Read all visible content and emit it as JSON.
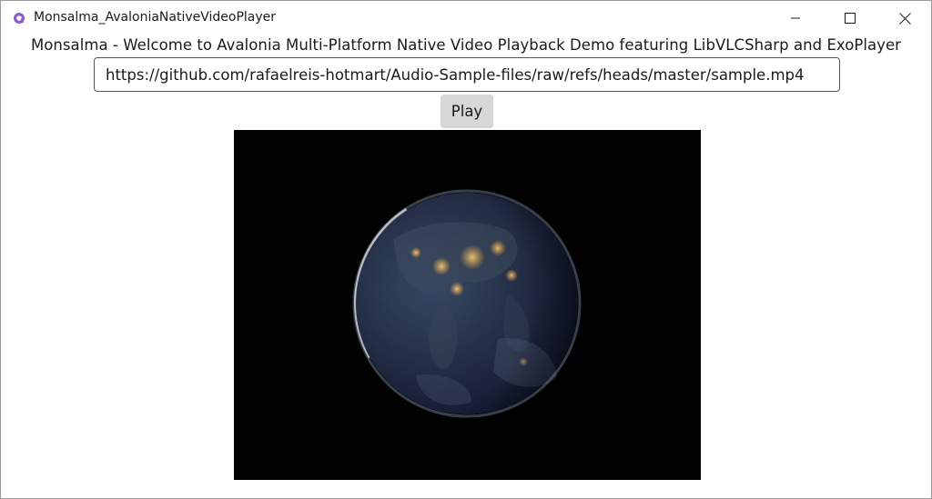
{
  "window": {
    "title": "Monsalma_AvaloniaNativeVideoPlayer",
    "controls": {
      "minimize_icon": "minimize-icon",
      "maximize_icon": "maximize-icon",
      "close_icon": "close-icon"
    },
    "app_icon": "avalonia-logo-icon",
    "accent_color": "#8b5ccf"
  },
  "main": {
    "heading": "Monsalma - Welcome to Avalonia Multi-Platform Native Video Playback Demo featuring LibVLCSharp and ExoPlayer",
    "url_input": {
      "value": "https://github.com/rafaelreis-hotmart/Audio-Sample-files/raw/refs/heads/master/sample.mp4",
      "placeholder": ""
    },
    "play_button_label": "Play",
    "video": {
      "content": "earth-at-night-frame",
      "background_color": "#010101"
    }
  }
}
